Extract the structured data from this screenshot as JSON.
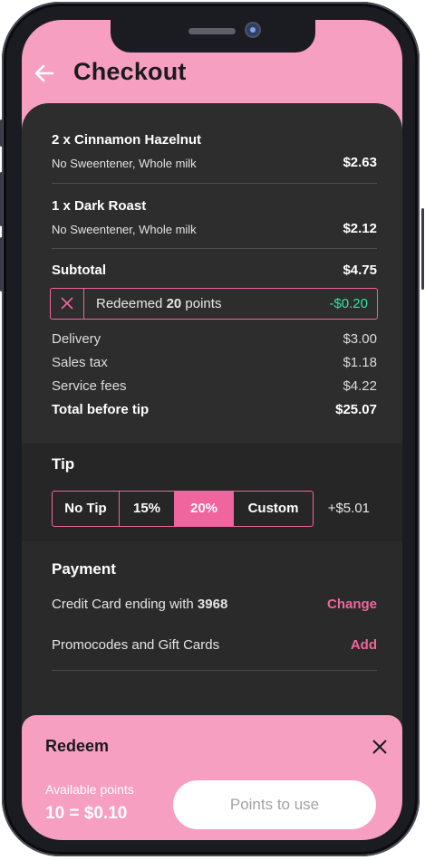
{
  "header": {
    "title": "Checkout"
  },
  "order": {
    "items": [
      {
        "name": "2 x Cinnamon Hazelnut",
        "options": "No Sweentener, Whole milk",
        "price": "$2.63"
      },
      {
        "name": "1 x Dark Roast",
        "options": "No Sweentener, Whole milk",
        "price": "$2.12"
      }
    ],
    "subtotal_label": "Subtotal",
    "subtotal_value": "$4.75"
  },
  "redemption": {
    "prefix": "Redeemed ",
    "points": "20",
    "suffix": " points",
    "amount": "-$0.20"
  },
  "fees": [
    {
      "label": "Delivery",
      "value": "$3.00"
    },
    {
      "label": "Sales tax",
      "value": "$1.18"
    },
    {
      "label": "Service fees",
      "value": "$4.22"
    }
  ],
  "total": {
    "label": "Total before tip",
    "value": "$25.07"
  },
  "tip": {
    "title": "Tip",
    "options": [
      "No Tip",
      "15%",
      "20%",
      "Custom"
    ],
    "selected": "20%",
    "amount": "+$5.01"
  },
  "payment": {
    "title": "Payment",
    "card_prefix": "Credit Card ending with ",
    "card_last4": "3968",
    "change_label": "Change",
    "promo_label": "Promocodes and Gift Cards",
    "add_label": "Add"
  },
  "redeem_sheet": {
    "title": "Redeem",
    "available_label": "Available points",
    "available_value": "10 = $0.10",
    "input_placeholder": "Points to use"
  },
  "colors": {
    "accent": "#f0659d",
    "header_pink": "#f79fc1",
    "discount_green": "#2ee6a6",
    "card_bg": "#2d2d2d"
  },
  "icons": {
    "back": "arrow-left-icon",
    "remove_redemption": "close-icon",
    "close_sheet": "close-icon"
  }
}
